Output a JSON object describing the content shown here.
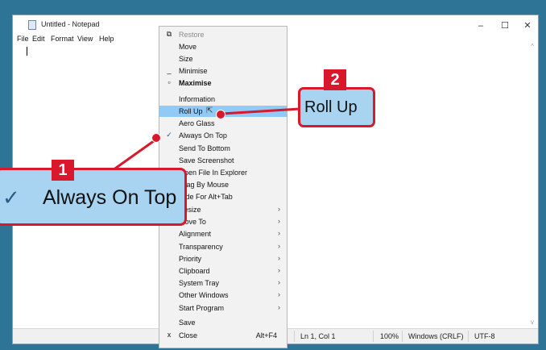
{
  "notepad": {
    "title": "Untitled - Notepad",
    "controls": {
      "minimize": "–",
      "maximize": "☐",
      "close": "✕"
    },
    "menu": [
      "File",
      "Edit",
      "Format",
      "View",
      "Help"
    ],
    "status": {
      "position": "Ln 1, Col 1",
      "zoom": "100%",
      "line_ending": "Windows (CRLF)",
      "encoding": "UTF-8"
    }
  },
  "context_menu": {
    "items": [
      {
        "label": "Restore",
        "icon": "restore-icon",
        "disabled": true
      },
      {
        "label": "Move"
      },
      {
        "label": "Size"
      },
      {
        "label": "Minimise",
        "icon": "minimise-icon"
      },
      {
        "label": "Maximise",
        "icon": "maximise-icon",
        "bold": true
      },
      {
        "label": "Information"
      },
      {
        "label": "Roll Up",
        "highlighted": true
      },
      {
        "label": "Aero Glass"
      },
      {
        "label": "Always On Top",
        "checked": true
      },
      {
        "label": "Send To Bottom"
      },
      {
        "label": "Save Screenshot"
      },
      {
        "label": "Open File In Explorer"
      },
      {
        "label": "Drag By Mouse"
      },
      {
        "label": "Hide For Alt+Tab"
      },
      {
        "label": "Resize",
        "submenu": true
      },
      {
        "label": "Move To",
        "submenu": true
      },
      {
        "label": "Alignment",
        "submenu": true
      },
      {
        "label": "Transparency",
        "submenu": true
      },
      {
        "label": "Priority",
        "submenu": true
      },
      {
        "label": "Clipboard",
        "submenu": true
      },
      {
        "label": "System Tray",
        "submenu": true
      },
      {
        "label": "Other Windows",
        "submenu": true
      },
      {
        "label": "Start Program",
        "submenu": true
      },
      {
        "label": "Save"
      },
      {
        "label": "Close",
        "shortcut": "Alt+F4",
        "icon": "close-icon"
      }
    ]
  },
  "callouts": {
    "one": {
      "number": "1",
      "text": "Always On Top",
      "check": "✓"
    },
    "two": {
      "number": "2",
      "text": "Roll Up"
    }
  },
  "colors": {
    "accent_red": "#d9182b",
    "highlight_blue": "#91c9f7",
    "desktop": "#2e7496"
  }
}
